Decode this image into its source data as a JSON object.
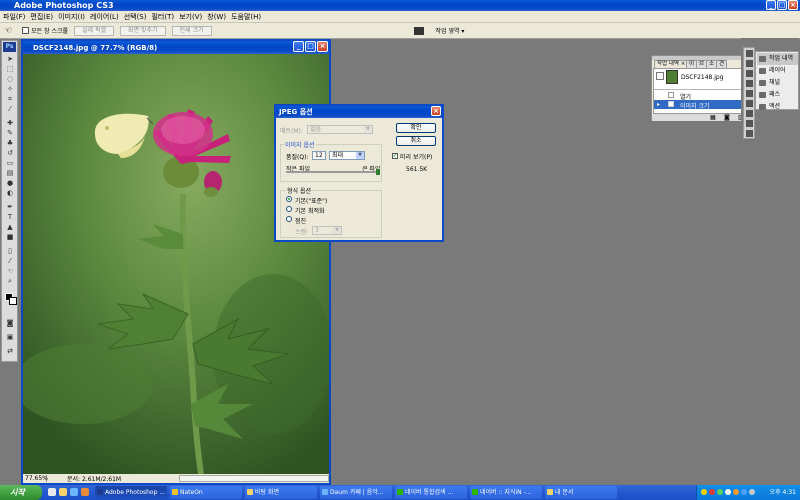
{
  "app": {
    "title": "Adobe Photoshop CS3",
    "window_controls": [
      "_",
      "□",
      "×"
    ]
  },
  "menu": [
    "파일(F)",
    "편집(E)",
    "이미지(I)",
    "레이어(L)",
    "선택(S)",
    "필터(T)",
    "보기(V)",
    "창(W)",
    "도움말(H)"
  ],
  "options_bar": {
    "scroll_all_label": "모든 창 스크롤",
    "actual_pixels": "실제 픽셀",
    "fit_screen": "화면 맞추기",
    "print_size": "인쇄 크기",
    "workspace_label": "작업 영역 ▾"
  },
  "tools": {
    "logo": "Ps"
  },
  "document": {
    "title": "DSCF2148.jpg @ 77.7% (RGB/8)",
    "zoom": "77.65%",
    "doc_info": "문서: 2.61M/2.61M"
  },
  "jpeg_dialog": {
    "title": "JPEG 옵션",
    "matte_label": "매트(M):",
    "matte_value": "없음",
    "image_options_legend": "이미지 옵션",
    "quality_label": "품질(Q):",
    "quality_value": "12",
    "quality_select": "최대",
    "small_file": "작은 파일",
    "large_file": "큰 파일",
    "quality_level": 1.0,
    "format_legend": "형식 옵션",
    "format_options": [
      "기본(\"표준\")",
      "기본 최적화",
      "점진"
    ],
    "selected_format": 0,
    "scans_label": "스캔:",
    "scans_value": "3",
    "ok_button": "확인",
    "cancel_button": "취소",
    "preview_label": "미리 보기(P)",
    "preview_checked": true,
    "file_size": "561.5K"
  },
  "history_panel": {
    "tabs": [
      "작업 내역 ×",
      "이",
      "브",
      "소",
      "견"
    ],
    "snapshot_name": "DSCF2148.jpg",
    "steps": [
      "열기",
      "이미지 크기"
    ],
    "selected_step": 1
  },
  "dock_panels": {
    "items": [
      "작업 내역",
      "레이어",
      "채널",
      "패스",
      "액션"
    ],
    "selected": 0
  },
  "taskbar": {
    "start": "시작",
    "tasks": [
      "Adobe Photoshop ...",
      "NateOn",
      "바탕 화면",
      "Daum 카페 | 음악...",
      "네이버 통합검색 ...",
      "네이버 :: 지식iN -...",
      "내 문서"
    ],
    "active_task": 0,
    "clock": "오후 4:31"
  },
  "colors": {
    "xp_blue": "#0b49c7",
    "start_green": "#3c9e3c",
    "tray_blue": "#0b78d9",
    "workspace_gray": "#7a7a7a"
  }
}
